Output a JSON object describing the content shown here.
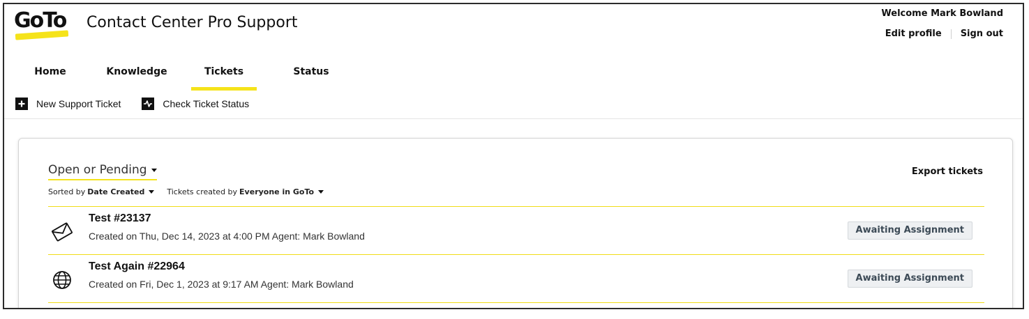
{
  "header": {
    "logo_text": "GoTo",
    "site_title": "Contact Center Pro Support",
    "welcome": "Welcome Mark Bowland",
    "edit_profile": "Edit profile",
    "sign_out": "Sign out"
  },
  "nav": {
    "items": [
      {
        "label": "Home"
      },
      {
        "label": "Knowledge"
      },
      {
        "label": "Tickets",
        "active": true
      },
      {
        "label": "Status"
      }
    ]
  },
  "subnav": {
    "new_ticket": "New Support Ticket",
    "check_status": "Check Ticket Status"
  },
  "tickets_panel": {
    "filter": "Open or Pending",
    "sorted_by_prefix": "Sorted by",
    "sorted_by_value": "Date Created",
    "created_by_prefix": "Tickets created by",
    "created_by_value": "Everyone in GoTo",
    "export_label": "Export tickets",
    "tickets": [
      {
        "icon": "envelope-icon",
        "title": "Test #23137",
        "meta": "Created on Thu, Dec 14, 2023 at 4:00 PM Agent: Mark Bowland",
        "status": "Awaiting Assignment"
      },
      {
        "icon": "globe-icon",
        "title": "Test Again #22964",
        "meta": "Created on Fri, Dec 1, 2023 at 9:17 AM Agent: Mark Bowland",
        "status": "Awaiting Assignment"
      }
    ]
  },
  "colors": {
    "accent_yellow": "#f5e31a",
    "badge_bg": "#eef0f2",
    "text_dark": "#111111"
  }
}
